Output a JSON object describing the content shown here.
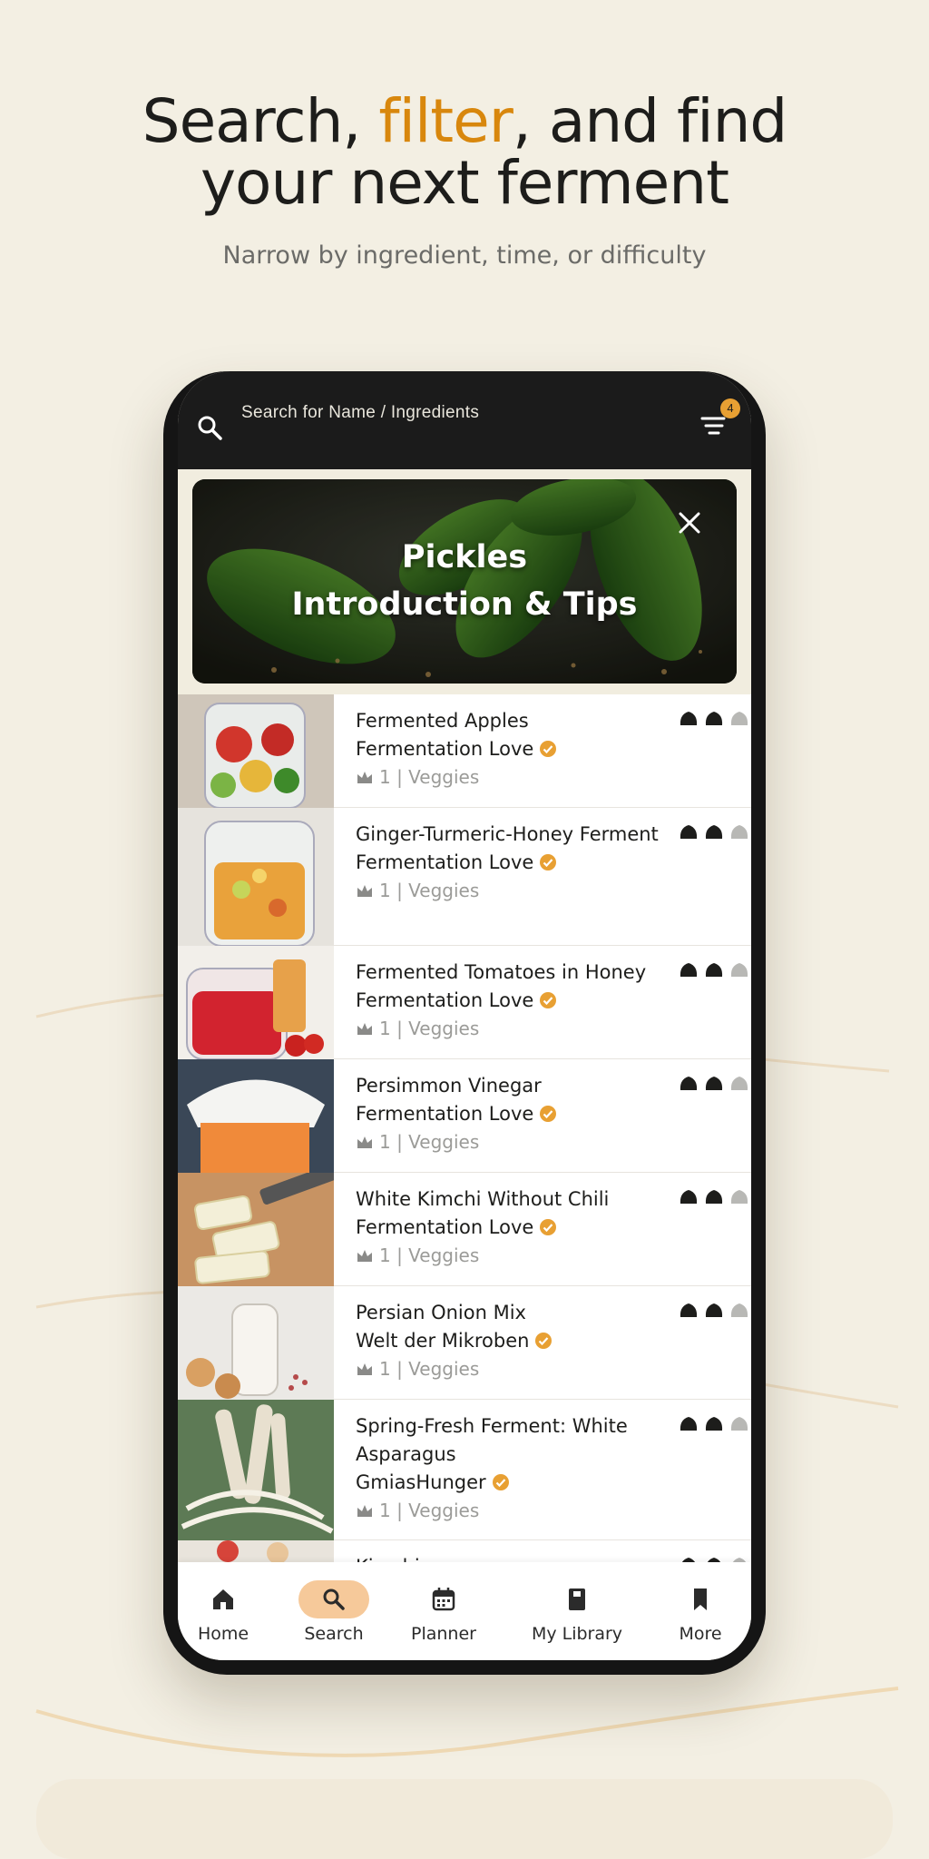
{
  "headline": {
    "part1": "Search, ",
    "accent": "filter",
    "part2": ", and find",
    "line2": "your next ferment"
  },
  "subheadline": "Narrow by ingredient, time, or difficulty",
  "search": {
    "placeholder": "Search for Name / Ingredients",
    "filter_count": "4"
  },
  "banner": {
    "title_line1": "Pickles",
    "title_line2": "Introduction & Tips"
  },
  "recipes": [
    {
      "title": "Fermented Apples",
      "author": "Fermentation Love",
      "meta": "1 | Veggies",
      "difficulty": 2
    },
    {
      "title": "Ginger-Turmeric-Honey Ferment",
      "author": "Fermentation Love",
      "meta": "1 | Veggies",
      "difficulty": 2
    },
    {
      "title": "Fermented Tomatoes in Honey",
      "author": "Fermentation Love",
      "meta": "1 | Veggies",
      "difficulty": 2
    },
    {
      "title": "Persimmon Vinegar",
      "author": "Fermentation Love",
      "meta": "1 | Veggies",
      "difficulty": 2
    },
    {
      "title": "White Kimchi Without Chili",
      "author": "Fermentation Love",
      "meta": "1 | Veggies",
      "difficulty": 2
    },
    {
      "title": "Persian Onion Mix",
      "author": "Welt der Mikroben",
      "meta": "1 | Veggies",
      "difficulty": 2
    },
    {
      "title": "Spring-Fresh Ferment: White Asparagus",
      "author": "GmiasHunger",
      "meta": "1 | Veggies",
      "difficulty": 2
    },
    {
      "title": "Kimchi",
      "author": "",
      "meta": "",
      "difficulty": 2
    }
  ],
  "nav": [
    {
      "label": "Home",
      "icon": "home-icon"
    },
    {
      "label": "Search",
      "icon": "search-icon",
      "active": true
    },
    {
      "label": "Planner",
      "icon": "calendar-icon"
    },
    {
      "label": "My Library",
      "icon": "book-icon"
    },
    {
      "label": "More",
      "icon": "bookmark-icon"
    }
  ],
  "colors": {
    "accent": "#d8870d",
    "badge": "#e8a033",
    "nav_active": "#f6c99a",
    "background": "#f3efe3"
  }
}
